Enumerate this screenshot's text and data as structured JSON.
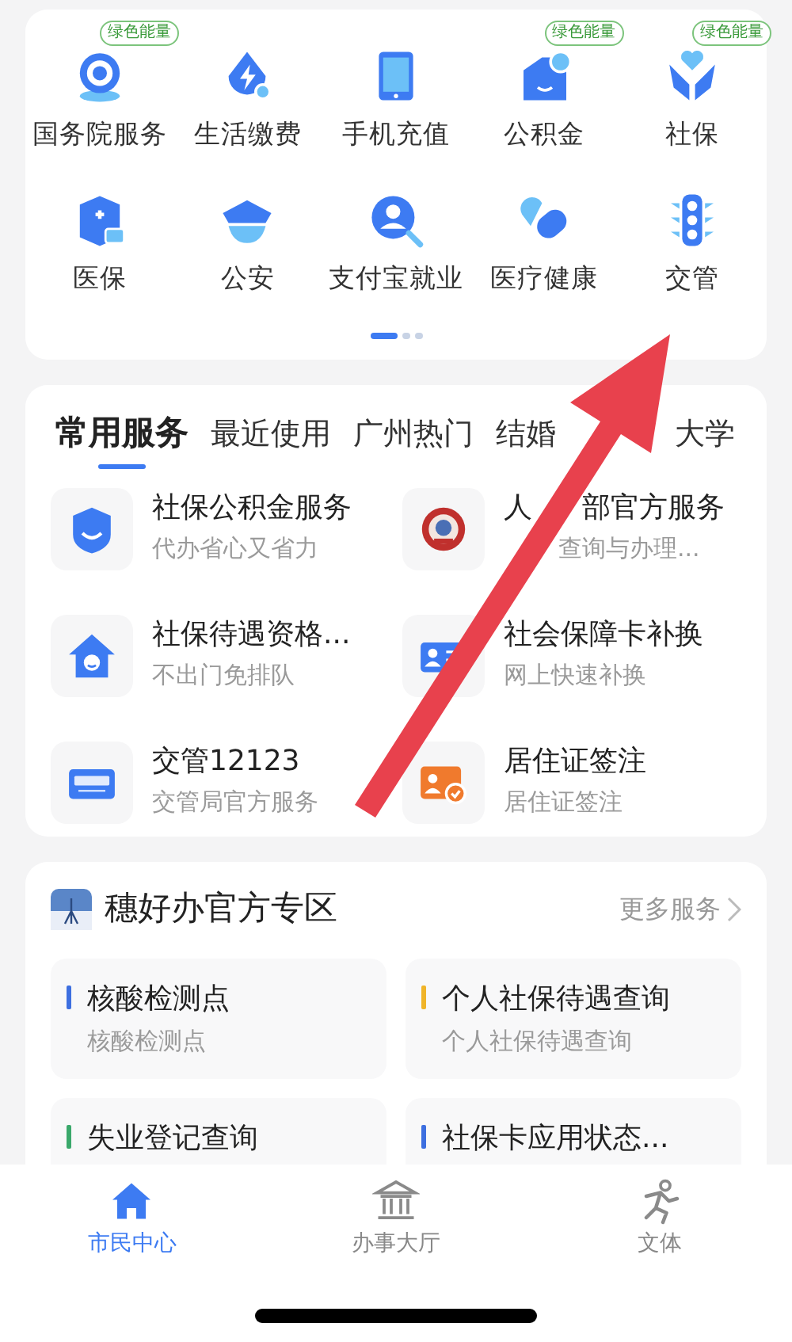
{
  "grid_services": [
    {
      "label": "国务院服务",
      "badge": "绿色能量"
    },
    {
      "label": "生活缴费"
    },
    {
      "label": "手机充值"
    },
    {
      "label": "公积金",
      "badge": "绿色能量"
    },
    {
      "label": "社保",
      "badge": "绿色能量"
    },
    {
      "label": "医保"
    },
    {
      "label": "公安"
    },
    {
      "label": "支付宝就业"
    },
    {
      "label": "医疗健康"
    },
    {
      "label": "交管"
    }
  ],
  "pager": [
    {
      "selected": true
    },
    {
      "selected": false
    },
    {
      "selected": false
    }
  ],
  "tabs": [
    {
      "label": "常用服务",
      "selected": true
    },
    {
      "label": "最近使用",
      "selected": false
    },
    {
      "label": "广州热门",
      "selected": false
    },
    {
      "label": "结婚",
      "selected": false
    },
    {
      "label": "大学",
      "selected": false,
      "gap_before": true
    }
  ],
  "services": [
    {
      "title_parts": [
        {
          "text": "社保公积金服务"
        }
      ],
      "subtitle_parts": [
        {
          "text": "代办省心又省力"
        }
      ]
    },
    {
      "title_parts": [
        {
          "text": "人"
        },
        {
          "text": "部官方服务",
          "gap_before": true
        }
      ],
      "subtitle_parts": [
        {
          "text": "查询与办理...",
          "gap_before": true
        }
      ]
    },
    {
      "title_parts": [
        {
          "text": "社保待遇资格..."
        }
      ],
      "subtitle_parts": [
        {
          "text": "不出门免排队"
        }
      ]
    },
    {
      "title_parts": [
        {
          "text": "社会保障卡补换"
        }
      ],
      "subtitle_parts": [
        {
          "text": "网上快速补换"
        }
      ]
    },
    {
      "title_parts": [
        {
          "text": "交管12123"
        }
      ],
      "subtitle_parts": [
        {
          "text": "交管局官方服务"
        }
      ]
    },
    {
      "title_parts": [
        {
          "text": "居住证签注"
        }
      ],
      "subtitle_parts": [
        {
          "text": "居住证签注"
        }
      ]
    }
  ],
  "official": {
    "title": "穗好办官方专区",
    "more": "更多服务",
    "items": [
      {
        "title": "核酸检测点",
        "subtitle": "核酸检测点",
        "color": "#3d6fe0"
      },
      {
        "title": "个人社保待遇查询",
        "subtitle": "个人社保待遇查询",
        "color": "#f0b429"
      },
      {
        "title": "失业登记查询",
        "color": "#3aa86b"
      },
      {
        "title": "社保卡应用状态...",
        "color": "#3d6fe0"
      }
    ]
  },
  "bottom_nav": [
    {
      "label": "市民中心",
      "selected": true
    },
    {
      "label": "办事大厅",
      "selected": false
    },
    {
      "label": "文体",
      "selected": false
    }
  ]
}
